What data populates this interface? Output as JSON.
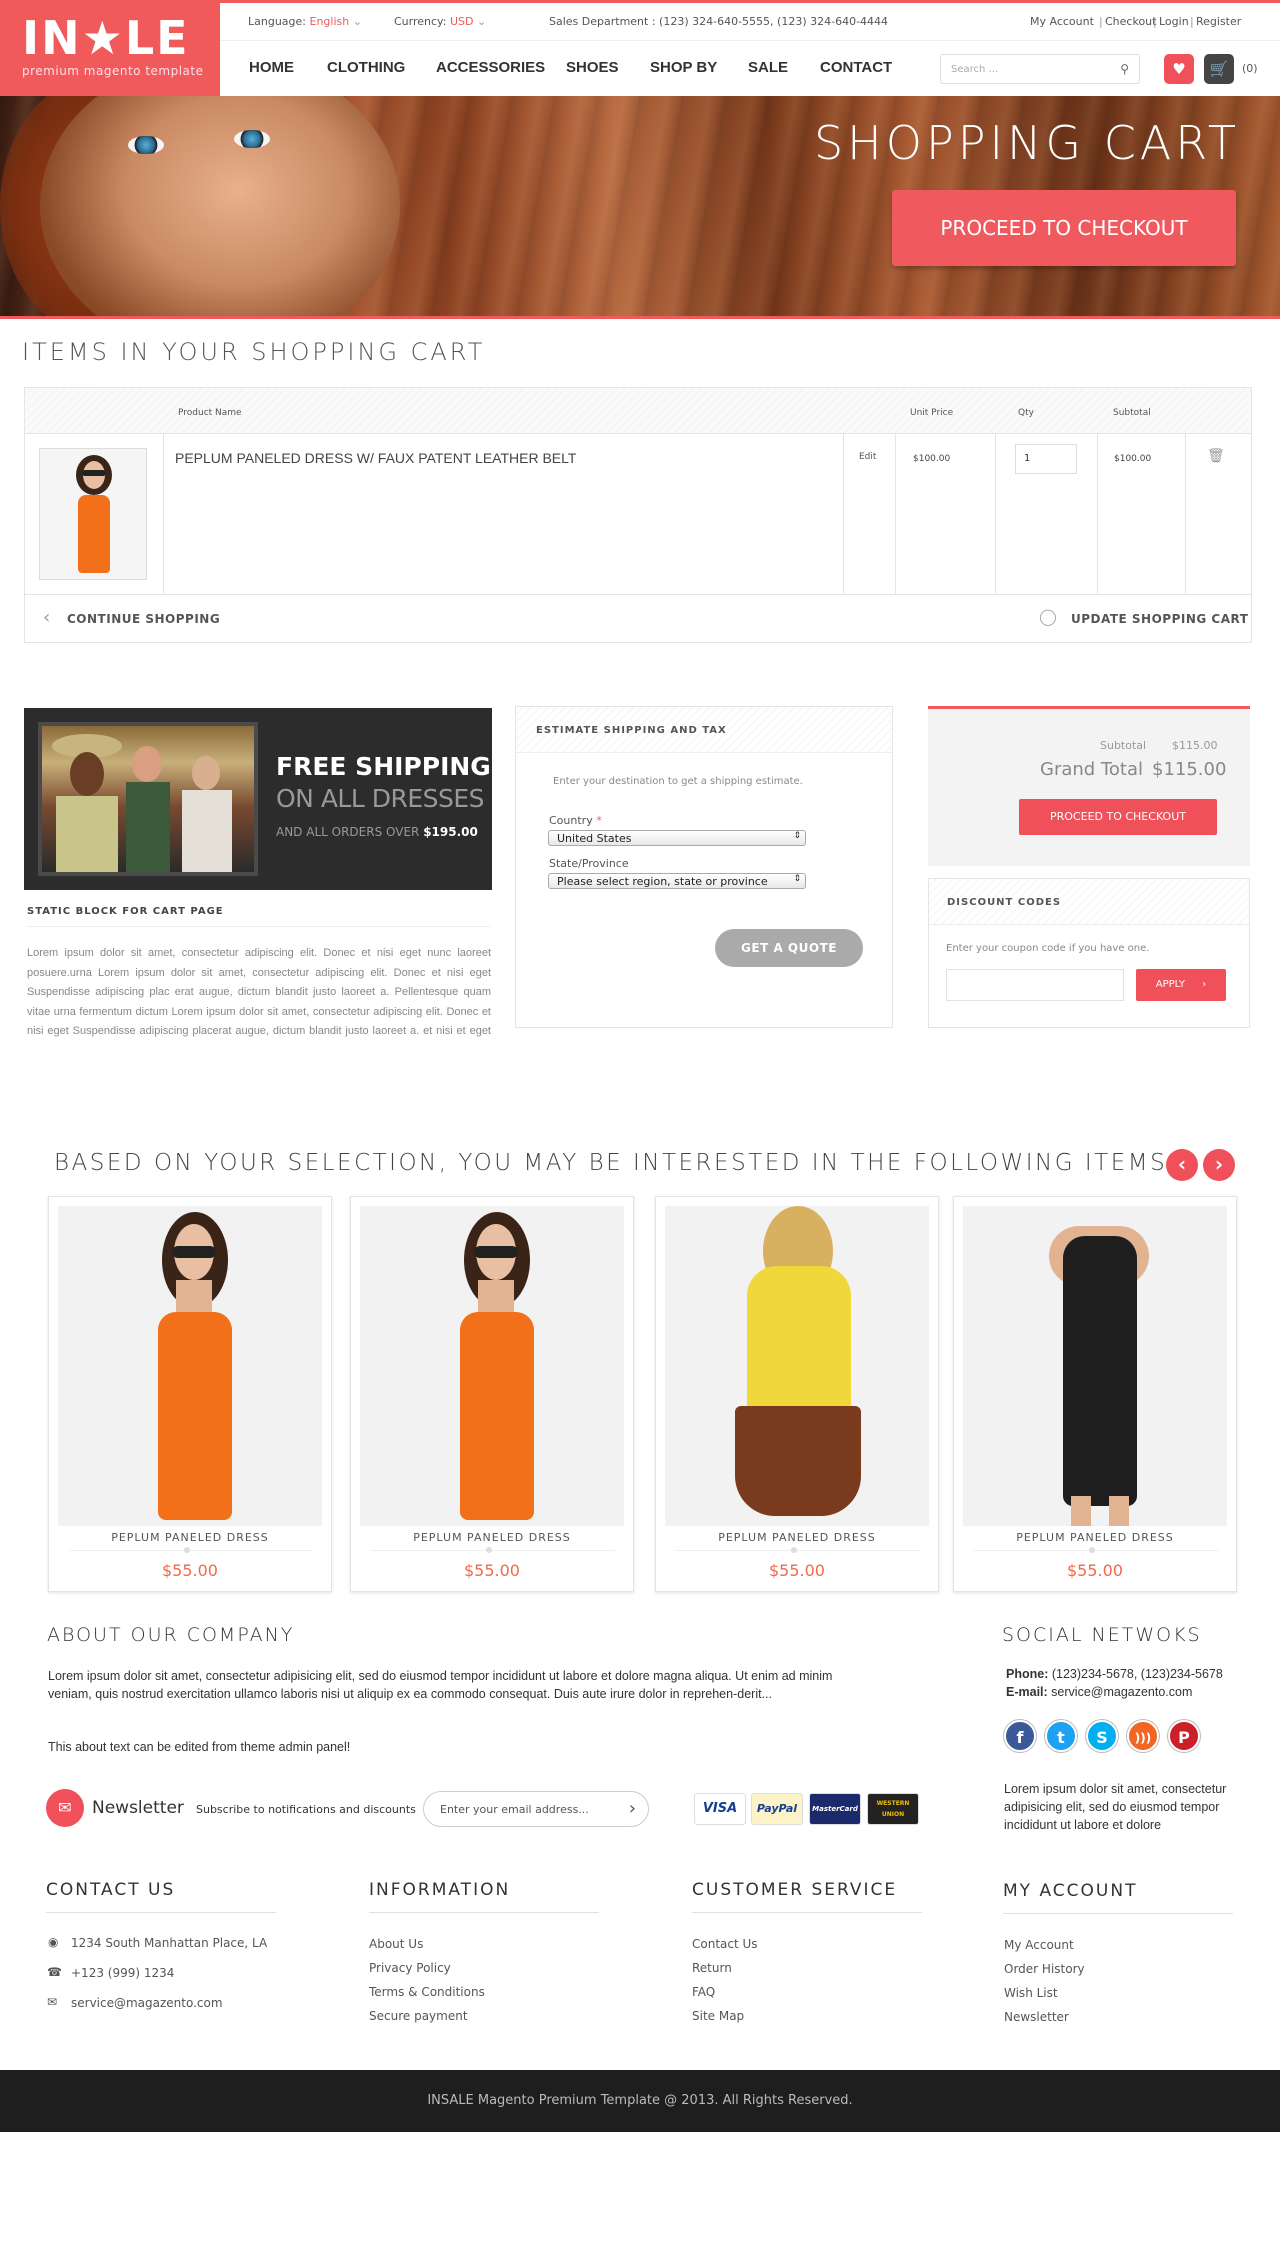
{
  "brand": {
    "logo_text": "INSALE",
    "logo_star": "★",
    "tagline": "premium magento template",
    "accent": "#f05a5a"
  },
  "topbar": {
    "language_label": "Language:",
    "language_value": "English",
    "currency_label": "Currency:",
    "currency_value": "USD",
    "sales": "Sales Department : (123) 324-640-5555, (123) 324-640-4444",
    "links": [
      "My Account",
      "Checkout",
      "Login",
      "Register"
    ]
  },
  "nav": {
    "items": [
      "HOME",
      "CLOTHING",
      "ACCESSORIES",
      "SHOES",
      "SHOP BY",
      "SALE",
      "CONTACT"
    ],
    "search_placeholder": "Search ...",
    "cart_count": "(0)"
  },
  "banner": {
    "title": "SHOPPING CART",
    "button": "PROCEED TO CHECKOUT"
  },
  "cart": {
    "heading": "ITEMS IN YOUR SHOPPING CART",
    "columns": {
      "name": "Product Name",
      "price": "Unit Price",
      "qty": "Qty",
      "subtotal": "Subtotal"
    },
    "item": {
      "name": "PEPLUM PANELED DRESS W/ FAUX PATENT LEATHER BELT",
      "edit": "Edit",
      "price": "$100.00",
      "qty": "1",
      "subtotal": "$100.00"
    },
    "continue": "CONTINUE SHOPPING",
    "update": "UPDATE SHOPPING CART"
  },
  "promo": {
    "line1": "FREE SHIPPING",
    "line2": "ON ALL DRESSES",
    "line3": "AND ALL ORDERS OVER",
    "amount": "$195.00"
  },
  "static_block": {
    "title": "STATIC BLOCK FOR CART PAGE",
    "text": "Lorem ipsum dolor sit amet, consectetur adipiscing elit. Donec et nisi eget nunc laoreet posuere.urna Lorem ipsum dolor sit amet, consectetur adipiscing elit. Donec et nisi eget Suspendisse adipiscing plac erat augue, dictum blandit justo laoreet a. Pellentesque quam vitae urna fermentum dictum Lorem ipsum dolor sit amet, consectetur adipiscing elit. Donec et nisi eget Suspendisse adipiscing placerat augue, dictum blandit justo laoreet a. et nisi et eget ellentesque quam vitae urna"
  },
  "estimate": {
    "title": "ESTIMATE SHIPPING AND TAX",
    "intro": "Enter your destination to get a shipping estimate.",
    "country_label": "Country",
    "required_mark": "*",
    "country_value": "United States",
    "state_label": "State/Province",
    "state_value": "Please select region, state or province",
    "button": "GET A QUOTE"
  },
  "totals": {
    "subtotal_label": "Subtotal",
    "subtotal": "$115.00",
    "grand_label": "Grand Total",
    "grand": "$115.00",
    "button": "PROCEED TO CHECKOUT"
  },
  "discount": {
    "title": "DISCOUNT CODES",
    "intro": "Enter your coupon code if you have one.",
    "button": "APPLY"
  },
  "related": {
    "heading": "BASED ON YOUR SELECTION, YOU MAY BE INTERESTED IN THE FOLLOWING ITEMS:",
    "items": [
      {
        "name": "PEPLUM PANELED DRESS",
        "price": "$55.00"
      },
      {
        "name": "PEPLUM PANELED DRESS",
        "price": "$55.00"
      },
      {
        "name": "PEPLUM PANELED DRESS",
        "price": "$55.00"
      },
      {
        "name": "PEPLUM PANELED DRESS",
        "price": "$55.00"
      }
    ]
  },
  "about": {
    "heading": "ABOUT OUR COMPANY",
    "text": "Lorem ipsum dolor sit amet, consectetur adipisicing elit, sed do eiusmod tempor incididunt ut labore et dolore magna aliqua. Ut enim ad minim veniam, quis nostrud exercitation ullamco laboris nisi ut aliquip ex ea commodo consequat. Duis aute irure dolor in reprehen-derit...",
    "note": "This about text can be edited from theme admin panel!"
  },
  "social": {
    "heading": "SOCIAL NETWOKS",
    "phone_label": "Phone:",
    "phone": "(123)234-5678, (123)234-5678",
    "email_label": "E-mail:",
    "email": "service@magazento.com",
    "icons": [
      "facebook-icon",
      "twitter-icon",
      "skype-icon",
      "rss-icon",
      "pinterest-icon"
    ],
    "text": "Lorem ipsum dolor sit amet, consectetur adipisicing elit, sed do eiusmod tempor incididunt ut labore et dolore"
  },
  "newsletter": {
    "title": "Newsletter",
    "subtitle": "Subscribe to notifications and discounts",
    "placeholder": "Enter your email address..."
  },
  "payments": [
    "VISA",
    "PayPal",
    "MasterCard",
    "WESTERN UNION"
  ],
  "footer": {
    "contact": {
      "heading": "CONTACT US",
      "address": "1234 South Manhattan Place, LA",
      "phone": "+123 (999) 1234",
      "email": "service@magazento.com"
    },
    "information": {
      "heading": "INFORMATION",
      "links": [
        "About Us",
        "Privacy Policy",
        "Terms & Conditions",
        "Secure payment"
      ]
    },
    "customer": {
      "heading": "CUSTOMER SERVICE",
      "links": [
        "Contact Us",
        "Return",
        "FAQ",
        "Site Map"
      ]
    },
    "account": {
      "heading": "MY ACCOUNT",
      "links": [
        "My Account",
        "Order History",
        "Wish List",
        "Newsletter"
      ]
    },
    "copyright": "INSALE Magento Premium Template @ 2013. All Rights Reserved."
  }
}
